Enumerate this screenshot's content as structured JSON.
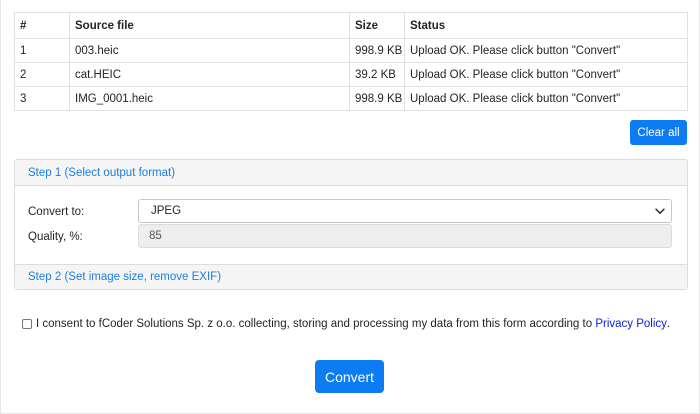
{
  "files_table": {
    "headers": {
      "number": "#",
      "source_file": "Source file",
      "size": "Size",
      "status": "Status"
    },
    "rows": [
      {
        "number": "1",
        "source_file": "003.heic",
        "size": "998.9 KB",
        "status": "Upload OK. Please click button \"Convert\""
      },
      {
        "number": "2",
        "source_file": "cat.HEIC",
        "size": "39.2 KB",
        "status": "Upload OK. Please click button \"Convert\""
      },
      {
        "number": "3",
        "source_file": "IMG_0001.heic",
        "size": "998.9 KB",
        "status": "Upload OK. Please click button \"Convert\""
      }
    ]
  },
  "clear_all_label": "Clear all",
  "step1": {
    "title": "Step 1 (Select output format)",
    "convert_to_label": "Convert to:",
    "format_selected": "JPEG",
    "quality_label": "Quality, %:",
    "quality_value": "85"
  },
  "step2": {
    "title": "Step 2 (Set image size, remove EXIF)"
  },
  "consent": {
    "text": "I consent to fCoder Solutions Sp. z o.o. collecting, storing and processing my data from this form according to",
    "link_text": "Privacy Policy",
    "trailing": "."
  },
  "convert_label": "Convert",
  "icons": {
    "select_arrow": "chevron-down-icon"
  },
  "colors": {
    "primary_button": "#0d7cf2",
    "step_header_text": "#1a7ee6",
    "link": "#0a1fd4"
  }
}
